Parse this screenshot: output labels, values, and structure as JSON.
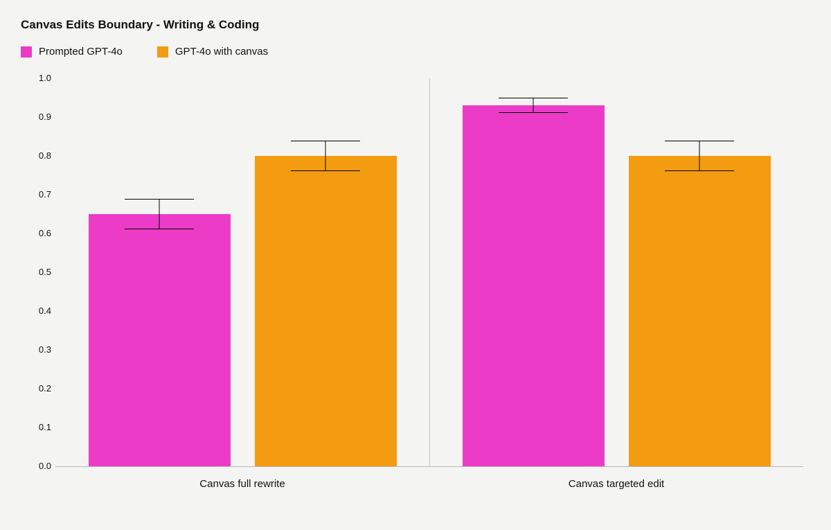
{
  "title": "Canvas Edits Boundary - Writing & Coding",
  "legend": {
    "s0": {
      "label": "Prompted GPT-4o",
      "color": "#ec3cc7"
    },
    "s1": {
      "label": "GPT-4o with canvas",
      "color": "#f39c12"
    }
  },
  "chart_data": {
    "type": "bar",
    "ylim": [
      0.0,
      1.0
    ],
    "yticks": [
      0.0,
      0.1,
      0.2,
      0.3,
      0.4,
      0.5,
      0.6,
      0.7,
      0.8,
      0.9,
      1.0
    ],
    "categories": [
      "Canvas full rewrite",
      "Canvas targeted edit"
    ],
    "series": [
      {
        "name": "Prompted GPT-4o",
        "color": "#ec3cc7",
        "values": [
          0.65,
          0.93
        ],
        "err": [
          0.04,
          0.02
        ]
      },
      {
        "name": "GPT-4o with canvas",
        "color": "#f39c12",
        "values": [
          0.8,
          0.8
        ],
        "err": [
          0.04,
          0.04
        ]
      }
    ]
  },
  "ylabels": {
    "t0": "0.0",
    "t1": "0.1",
    "t2": "0.2",
    "t3": "0.3",
    "t4": "0.4",
    "t5": "0.5",
    "t6": "0.6",
    "t7": "0.7",
    "t8": "0.8",
    "t9": "0.9",
    "t10": "1.0"
  },
  "xlabels": {
    "g0": "Canvas full rewrite",
    "g1": "Canvas targeted edit"
  }
}
